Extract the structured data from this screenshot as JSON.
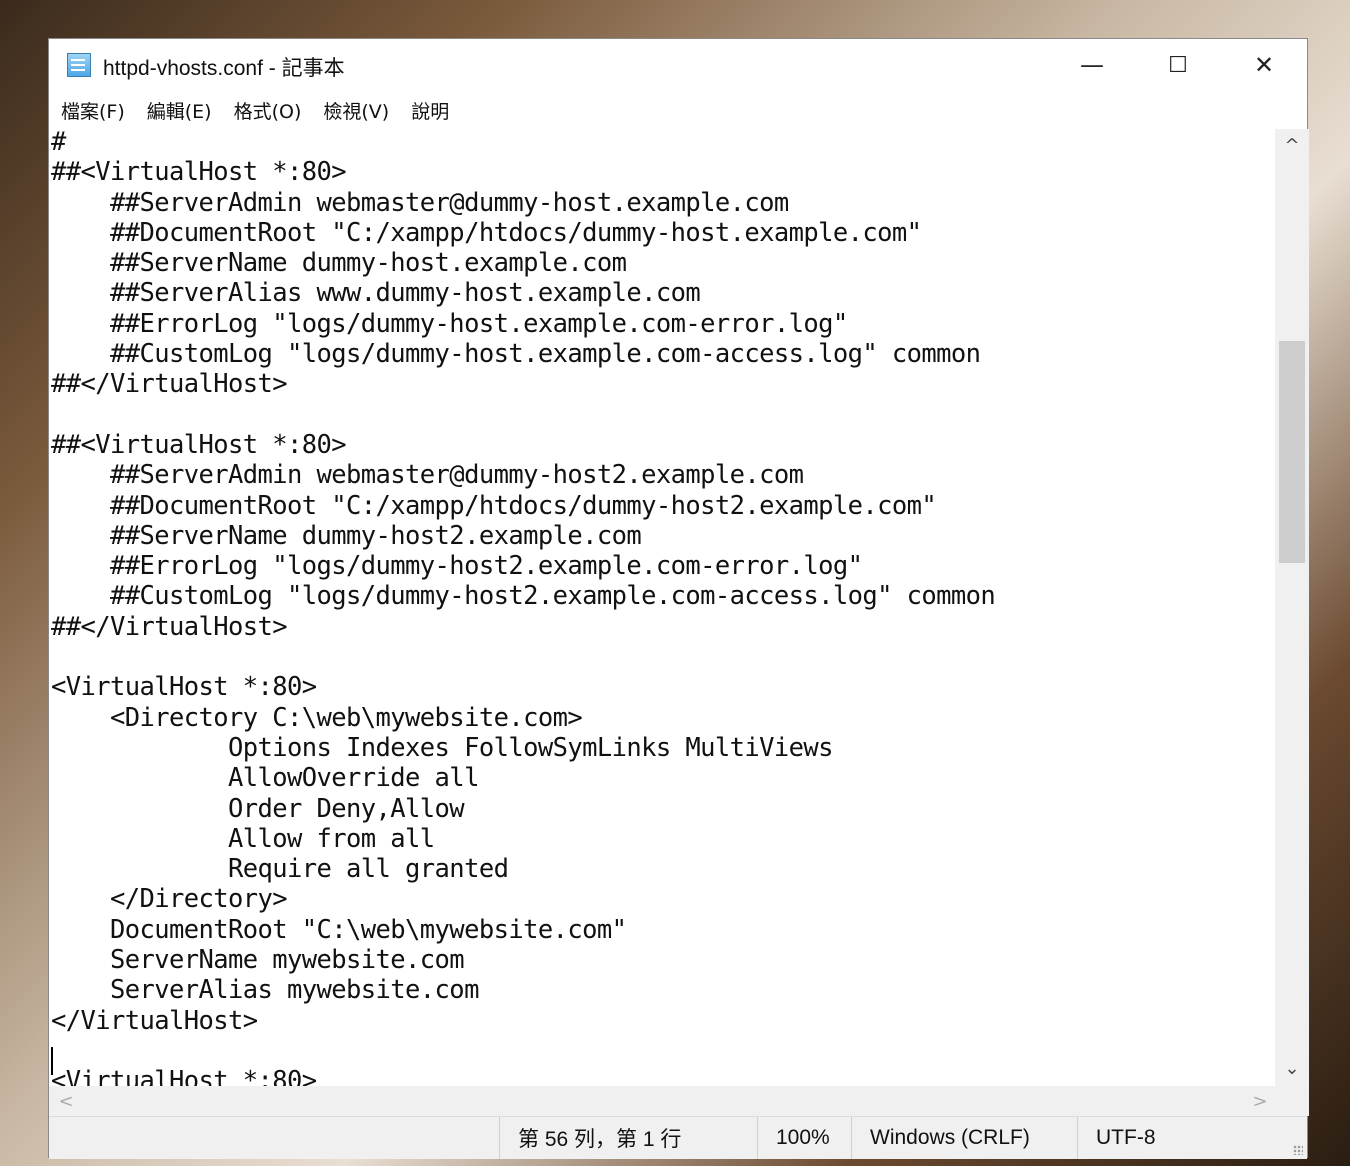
{
  "window": {
    "title": "httpd-vhosts.conf - 記事本",
    "controls": {
      "minimize": "—",
      "maximize": "☐",
      "close": "✕"
    }
  },
  "menu": {
    "items": [
      "檔案(F)",
      "編輯(E)",
      "格式(O)",
      "檢視(V)",
      "說明"
    ]
  },
  "editor": {
    "content": "#\n##<VirtualHost *:80>\n    ##ServerAdmin webmaster@dummy-host.example.com\n    ##DocumentRoot \"C:/xampp/htdocs/dummy-host.example.com\"\n    ##ServerName dummy-host.example.com\n    ##ServerAlias www.dummy-host.example.com\n    ##ErrorLog \"logs/dummy-host.example.com-error.log\"\n    ##CustomLog \"logs/dummy-host.example.com-access.log\" common\n##</VirtualHost>\n\n##<VirtualHost *:80>\n    ##ServerAdmin webmaster@dummy-host2.example.com\n    ##DocumentRoot \"C:/xampp/htdocs/dummy-host2.example.com\"\n    ##ServerName dummy-host2.example.com\n    ##ErrorLog \"logs/dummy-host2.example.com-error.log\"\n    ##CustomLog \"logs/dummy-host2.example.com-access.log\" common\n##</VirtualHost>\n\n<VirtualHost *:80>\n    <Directory C:\\web\\mywebsite.com>\n            Options Indexes FollowSymLinks MultiViews\n            AllowOverride all\n            Order Deny,Allow\n            Allow from all\n            Require all granted\n    </Directory>\n    DocumentRoot \"C:\\web\\mywebsite.com\"\n    ServerName mywebsite.com\n    ServerAlias mywebsite.com\n</VirtualHost>\n\n<VirtualHost *:80>"
  },
  "scroll": {
    "up_arrow": "^",
    "down_arrow": "⌄",
    "left_arrow": "<",
    "right_arrow": ">"
  },
  "status": {
    "position": "第 56 列，第 1 行",
    "zoom": "100%",
    "line_ending": "Windows (CRLF)",
    "encoding": "UTF-8"
  }
}
